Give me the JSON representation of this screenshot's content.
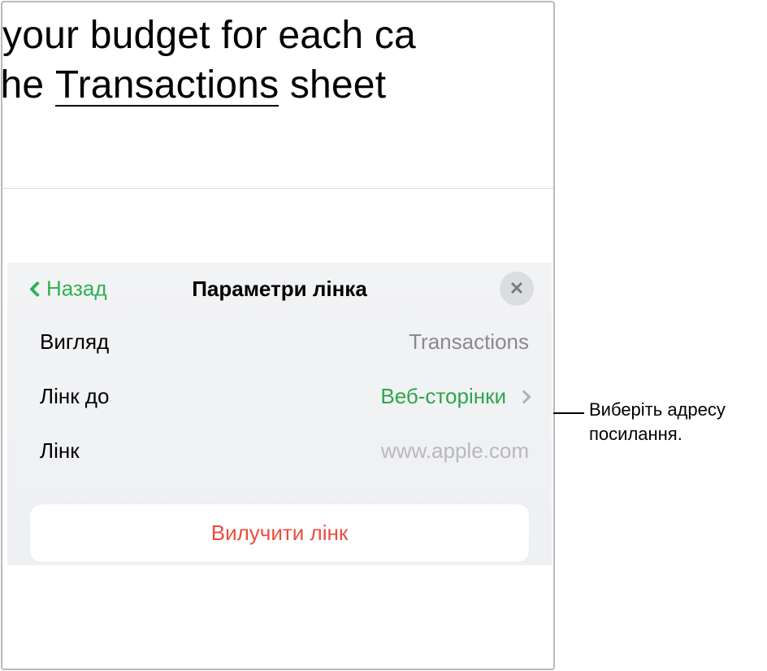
{
  "document": {
    "line1_prefix": "your budget for each ca",
    "line2_prefix": " the ",
    "highlighted": "Transactions",
    "line2_suffix": " sheet"
  },
  "popover": {
    "back_label": "Назад",
    "title": "Параметри лінка",
    "rows": {
      "display": {
        "label": "Вигляд",
        "value": "Transactions"
      },
      "linkto": {
        "label": "Лінк до",
        "value": "Веб-сторінки"
      },
      "link": {
        "label": "Лінк",
        "placeholder": "www.apple.com"
      }
    },
    "remove_label": "Вилучити лінк"
  },
  "callout": {
    "text_line1": "Виберіть адресу",
    "text_line2": "посилання."
  }
}
